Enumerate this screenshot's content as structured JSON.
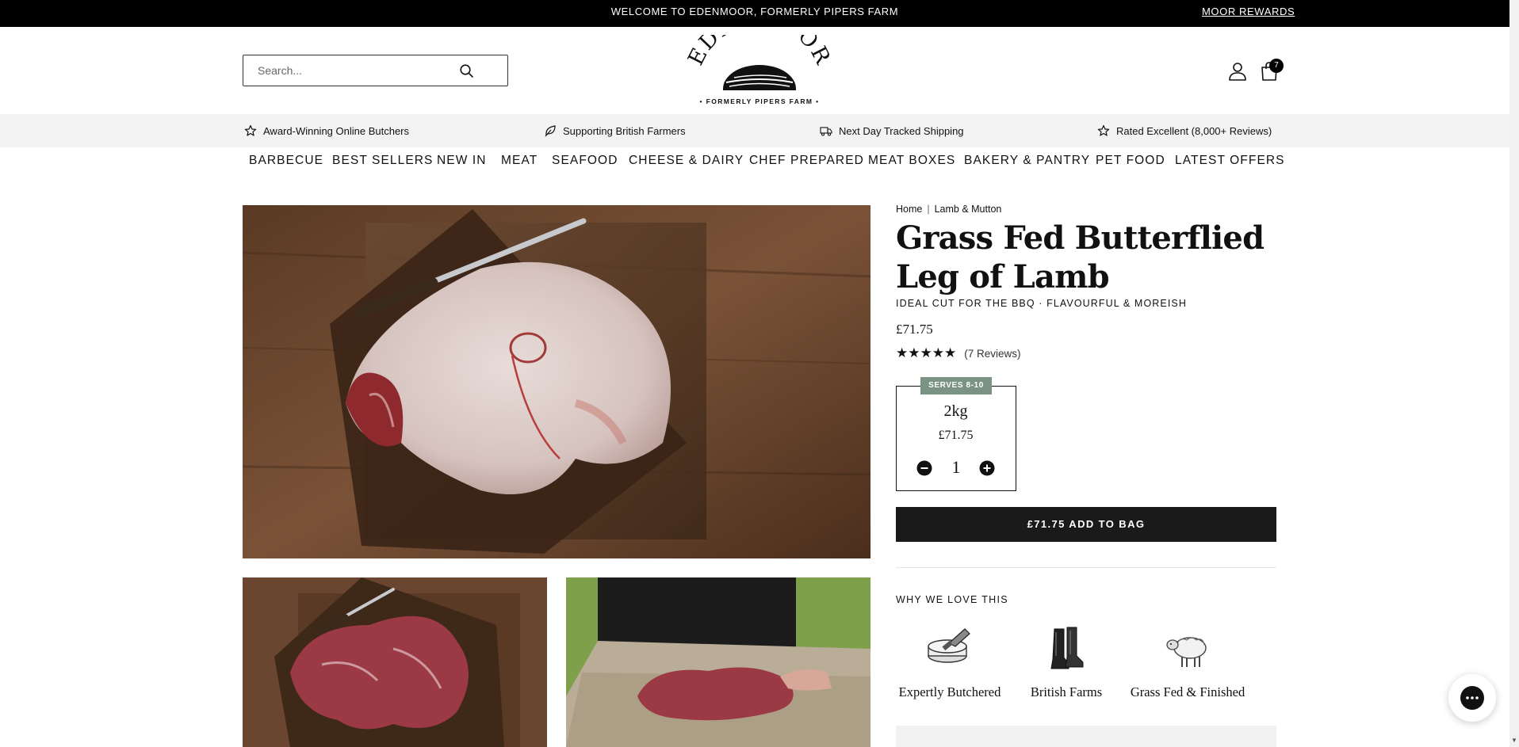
{
  "announcement": {
    "text": "WELCOME TO EDENMOOR, FORMERLY PIPERS FARM",
    "rewards_link": "MOOR REWARDS"
  },
  "header": {
    "search_placeholder": "Search...",
    "logo_text": "EDENMOOR",
    "logo_subtitle": "• FORMERLY PIPERS FARM •",
    "bag_count": "7"
  },
  "usps": [
    {
      "icon": "star-icon",
      "label": "Award-Winning Online Butchers"
    },
    {
      "icon": "leaf-icon",
      "label": "Supporting British Farmers"
    },
    {
      "icon": "truck-icon",
      "label": "Next Day Tracked Shipping"
    },
    {
      "icon": "star-icon",
      "label": "Rated Excellent (8,000+ Reviews)"
    }
  ],
  "nav": [
    "BARBECUE",
    "BEST SELLERS",
    "NEW IN",
    "MEAT",
    "SEAFOOD",
    "CHEESE & DAIRY",
    "CHEF PREPARED",
    "MEAT BOXES",
    "BAKERY & PANTRY",
    "PET FOOD",
    "LATEST OFFERS"
  ],
  "breadcrumb": [
    "Home",
    "Lamb & Mutton"
  ],
  "product": {
    "title": "Grass Fed Butterflied Leg of Lamb",
    "subtitle": "IDEAL CUT FOR THE BBQ · FLAVOURFUL & MOREISH",
    "price": "£71.75",
    "stars": "★★★★★",
    "rating": 5,
    "reviews": "(7 Reviews)"
  },
  "variant": {
    "badge": "SERVES 8-10",
    "weight": "2kg",
    "price": "£71.75",
    "quantity": "1"
  },
  "add_to_bag": "£71.75 ADD TO BAG",
  "why": {
    "heading": "WHY WE LOVE THIS",
    "features": [
      "Expertly Butchered",
      "British Farms",
      "Grass Fed & Finished"
    ]
  },
  "colors": {
    "announcement_bg": "#000000",
    "usp_bg": "#f3f3f3",
    "badge_green": "#7a9383",
    "button_bg": "#1a1a1a"
  }
}
